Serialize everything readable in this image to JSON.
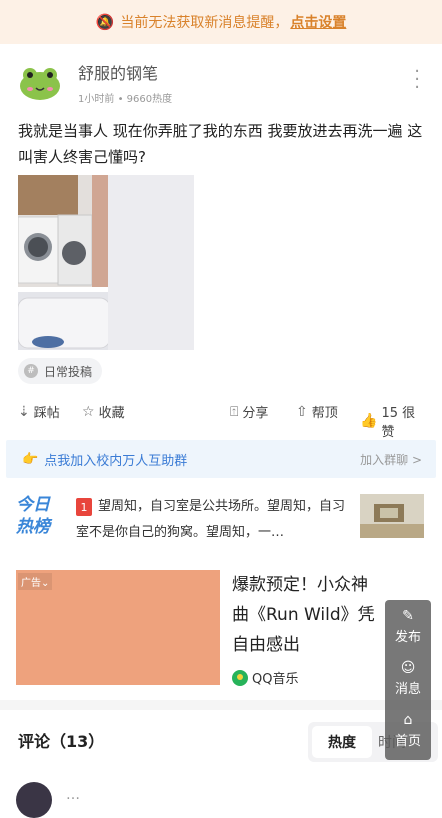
{
  "banner": {
    "text": "当前无法获取新消息提醒，",
    "link": "点击设置"
  },
  "post": {
    "author": "舒服的钢笔",
    "time": "1小时前",
    "heat": "9660热度",
    "text": "我就是当事人 现在你弄脏了我的东西 我要放进去再洗一遍 这叫害人终害己懂吗?",
    "tag": "日常投稿"
  },
  "actions": {
    "stamp": "踩帖",
    "favorite": "收藏",
    "share": "分享",
    "top": "帮顶",
    "likes": "15 很赞"
  },
  "group_bar": {
    "text": "点我加入校内万人互助群",
    "right": "加入群聊 >"
  },
  "hot": {
    "logo_line1": "今日",
    "logo_line2": "热榜",
    "rank": "1",
    "text": "望周知，自习室是公共场所。望周知，自习室不是你自己的狗窝。望周知，一…"
  },
  "ad": {
    "label": "广告",
    "title": "爆款预定！小众神曲《Run Wild》凭自由感出",
    "source": "QQ音乐"
  },
  "comments": {
    "title": "评论（13）",
    "sort_hot": "热度",
    "sort_time": "时间"
  },
  "float_menu": {
    "post": "发布",
    "messages": "消息",
    "home": "首页"
  },
  "next_comment": {
    "author": "…"
  }
}
